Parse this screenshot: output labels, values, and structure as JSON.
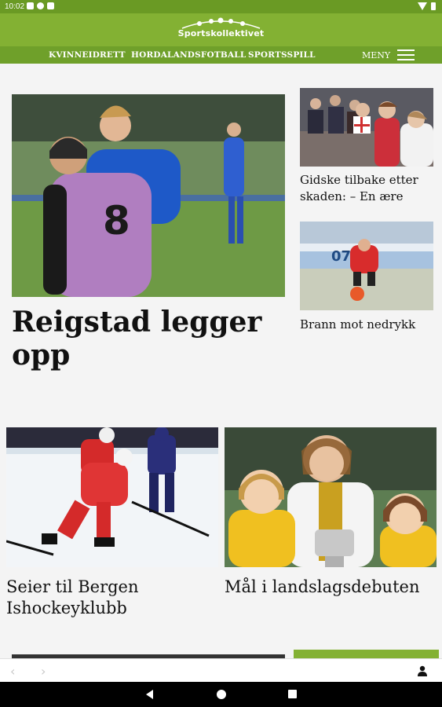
{
  "status_bar": {
    "time": "10:02"
  },
  "site": {
    "name": "Sportskollektivet",
    "brand_color": "#83b133",
    "nav_color": "#6fa02a"
  },
  "nav": {
    "items": [
      {
        "label": "KVINNEIDRETT"
      },
      {
        "label": "HORDALANDSFOTBALL"
      },
      {
        "label": "SPORTSSPILL"
      }
    ],
    "menu_label": "MENY"
  },
  "articles": {
    "main": {
      "headline": "Reigstad legger opp",
      "image": "football-player-jersey-8-photo"
    },
    "side_top": {
      "headline": "Gidske tilbake etter skaden: – En ære",
      "image": "women-football-team-photo"
    },
    "side_bottom": {
      "headline": "Brann mot nedrykk",
      "image": "player-with-ball-photo"
    },
    "grid_left": {
      "headline": "Seier til Bergen Ishockeyklubb",
      "image": "ice-hockey-photo"
    },
    "grid_right": {
      "headline": "Mål i landslagsdebuten",
      "image": "player-with-trophy-photo"
    }
  },
  "browser_bar": {
    "back_icon": "chevron-left-icon",
    "forward_icon": "chevron-right-icon",
    "account_icon": "person-icon"
  },
  "system_nav": {
    "back": "back-triangle-icon",
    "home": "home-circle-icon",
    "recents": "recents-square-icon"
  }
}
